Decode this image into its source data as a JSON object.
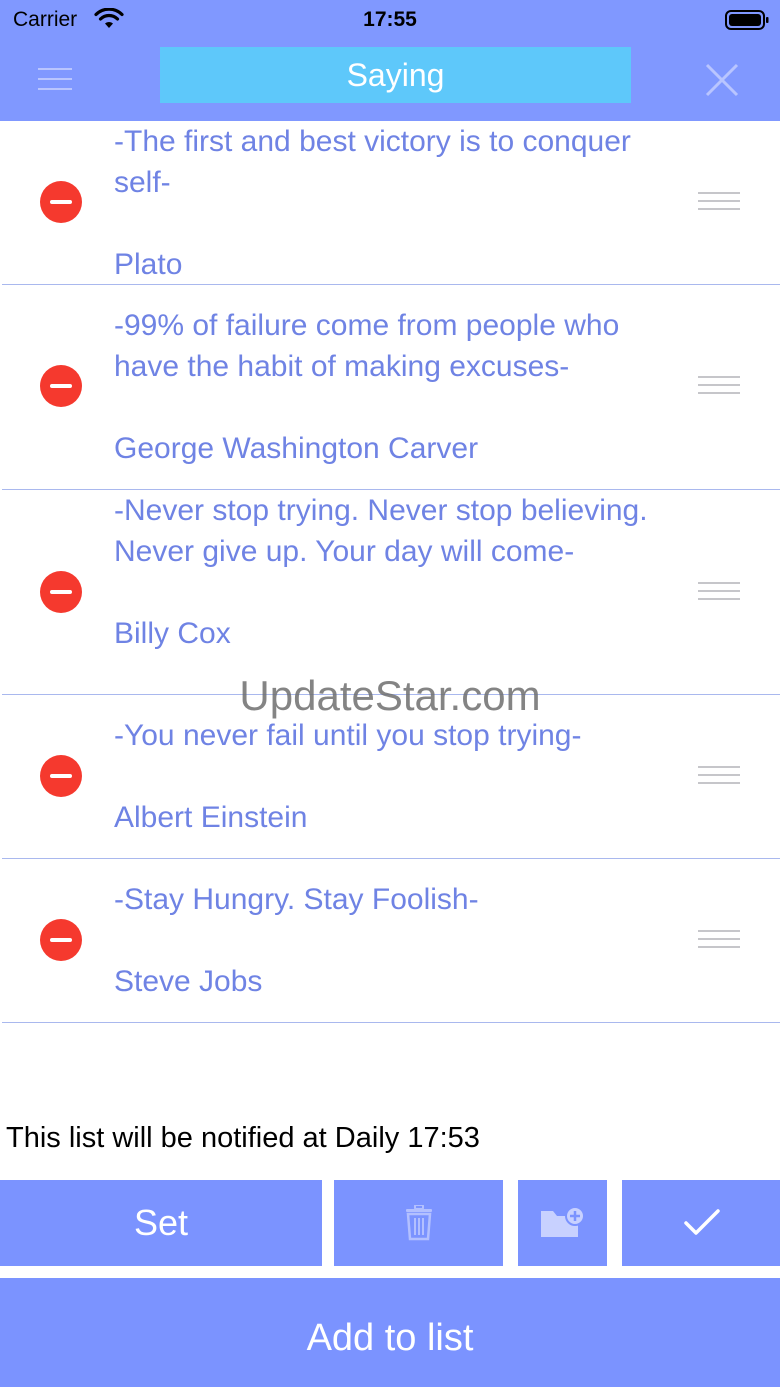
{
  "status_bar": {
    "carrier": "Carrier",
    "time": "17:55"
  },
  "header": {
    "title": "Saying",
    "menu_icon": "hamburger-icon",
    "close_icon": "close-icon"
  },
  "items": [
    {
      "quote": "-The first and best victory is to conquer self-",
      "author": "Plato"
    },
    {
      "quote": "-99% of failure come from people who have the habit of making excuses-",
      "author": "George Washington Carver"
    },
    {
      "quote": "-Never stop trying. Never stop believing. Never give up. Your day will come-",
      "author": "Billy Cox"
    },
    {
      "quote": "-You never fail until you stop trying-",
      "author": "Albert Einstein"
    },
    {
      "quote": "-Stay Hungry. Stay Foolish-",
      "author": "Steve Jobs"
    }
  ],
  "watermark": "UpdateStar.com",
  "notification": "This list will be notified at Daily 17:53",
  "toolbar": {
    "set_label": "Set",
    "trash_icon": "trash-icon",
    "folder_icon": "folder-add-icon",
    "check_icon": "checkmark-icon"
  },
  "add_label": "Add to list",
  "colors": {
    "header": "#8098ff",
    "title_box": "#5ec8fa",
    "text": "#6f83e4",
    "button": "#7b93ff",
    "delete": "#f5392e"
  }
}
